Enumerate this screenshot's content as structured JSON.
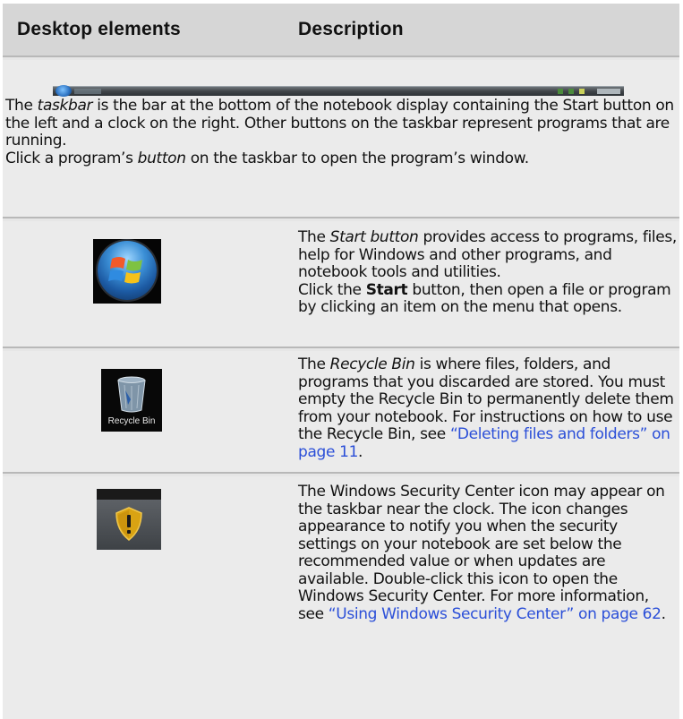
{
  "header": {
    "col1": "Desktop elements",
    "col2": "Description"
  },
  "rows": {
    "taskbar": {
      "image_icon": "taskbar-screenshot-icon",
      "line1_pre": "The ",
      "term": "taskbar",
      "line1_post": " is the bar at the bottom of the notebook display containing the Start button on the left and a clock on the right. Other buttons on the taskbar represent programs that are running.",
      "line2_pre": "Click a program’s ",
      "term2": "button",
      "line2_post": " on the taskbar to open the program’s window."
    },
    "start": {
      "image_icon": "windows-start-orb-icon",
      "term": "Start button",
      "p1_post": " provides access to programs, files, help for Windows and other programs, and notebook tools and utilities.",
      "p2_pre": "Click the ",
      "bold": "Start",
      "p2_post": " button, then open a file or program by clicking an item on the menu that opens.",
      "p1_pre": "The "
    },
    "recycle": {
      "image_icon": "recycle-bin-icon",
      "image_label": "Recycle Bin",
      "pre": "The ",
      "term": "Recycle Bin",
      "post": " is where files, folders, and programs that you discarded are stored. You must empty the Recycle Bin to permanently delete them from your notebook. For instructions on how to use the Recycle Bin, see ",
      "link": "“Deleting files and folders” on page 11",
      "end": "."
    },
    "security": {
      "image_icon": "security-center-shield-icon",
      "pre": "The Windows Security Center icon may appear on the taskbar near the clock. The icon changes appearance to notify you when the security settings on your notebook are set below the recommended value or when updates are available. Double-click this icon to open the Windows Security Center. For more information, see ",
      "link": "“Using Windows Security Center” on page 62",
      "end": "."
    }
  },
  "colors": {
    "header_bg": "#d6d6d6",
    "row_bg": "#ebebeb",
    "link": "#2b4fd8"
  }
}
